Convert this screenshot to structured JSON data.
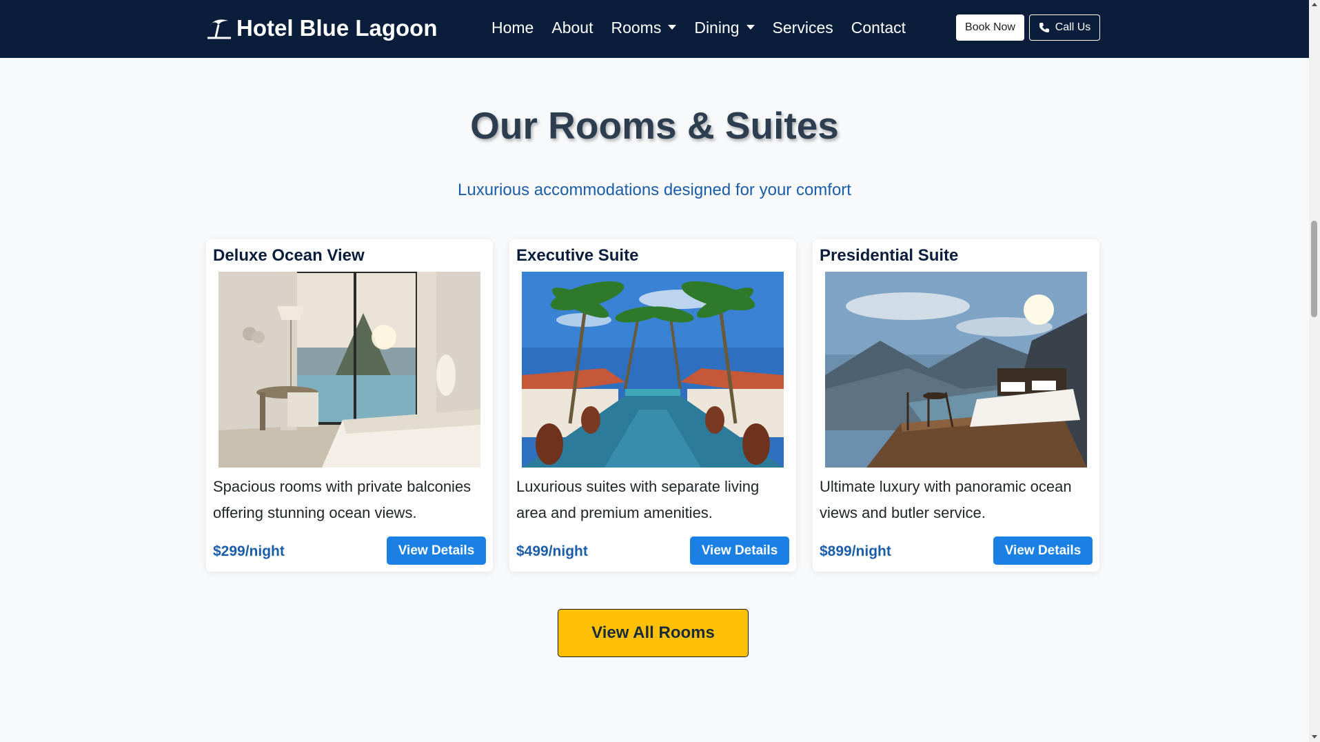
{
  "navbar": {
    "brand": "Hotel Blue Lagoon",
    "brand_icon": "beach-umbrella-icon",
    "links": [
      {
        "label": "Home",
        "dropdown": false
      },
      {
        "label": "About",
        "dropdown": false
      },
      {
        "label": "Rooms",
        "dropdown": true
      },
      {
        "label": "Dining",
        "dropdown": true
      },
      {
        "label": "Services",
        "dropdown": false
      },
      {
        "label": "Contact",
        "dropdown": false
      }
    ],
    "book_label": "Book Now",
    "call_label": "Call Us",
    "call_icon": "phone-icon"
  },
  "section": {
    "title": "Our Rooms & Suites",
    "subtitle": "Luxurious accommodations designed for your comfort"
  },
  "rooms": [
    {
      "title": "Deluxe Ocean View",
      "image": "hotel-room-ocean-view-photo",
      "description": "Spacious rooms with private balconies offering stunning ocean views.",
      "price": "$299/night",
      "button": "View Details"
    },
    {
      "title": "Executive Suite",
      "image": "palm-tree-pool-villa-photo",
      "description": "Luxurious suites with separate living area and premium amenities.",
      "price": "$499/night",
      "button": "View Details"
    },
    {
      "title": "Presidential Suite",
      "image": "mountain-terrace-bed-photo",
      "description": "Ultimate luxury with panoramic ocean views and butler service.",
      "price": "$899/night",
      "button": "View Details"
    }
  ],
  "view_all_label": "View All Rooms",
  "colors": {
    "navbar_bg": "#0a1e3c",
    "accent_blue": "#1b80e4",
    "price_blue": "#1a5da8",
    "cta_yellow": "#ffc107"
  }
}
